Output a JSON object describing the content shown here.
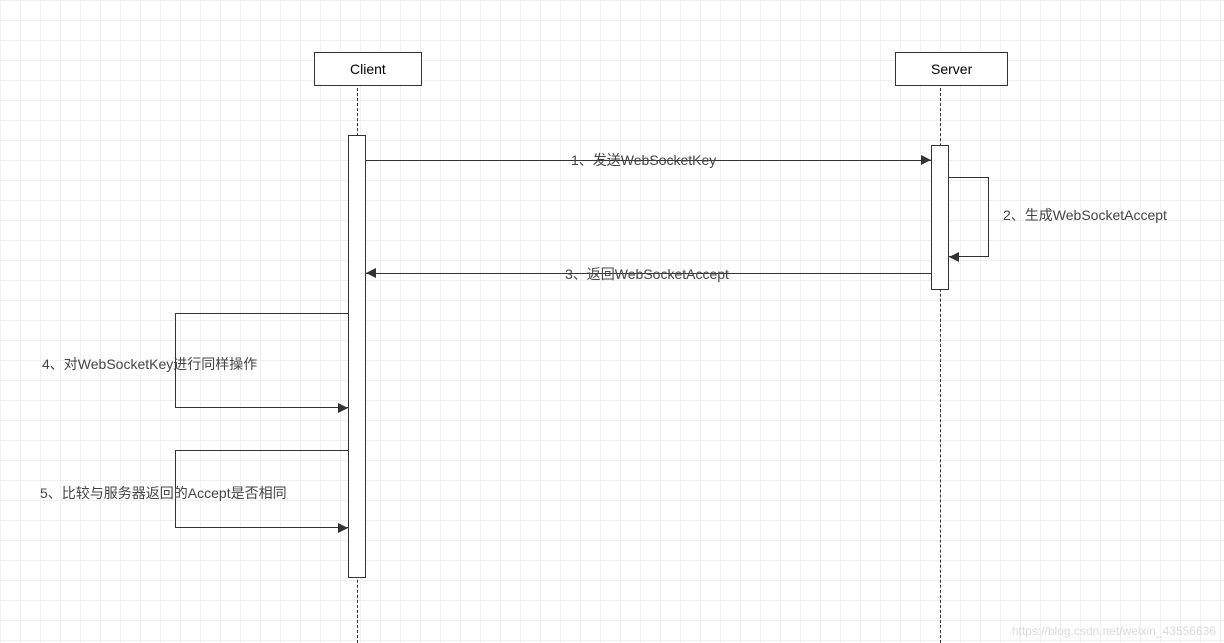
{
  "actors": {
    "client": "Client",
    "server": "Server"
  },
  "messages": {
    "msg1": "1、发送WebSocketKey",
    "msg2": "2、生成WebSocketAccept",
    "msg3": "3、返回WebSocketAccept",
    "msg4": "4、对WebSocketKey进行同样操作",
    "msg5": "5、比较与服务器返回的Accept是否相同"
  },
  "watermark": "https://blog.csdn.net/weixin_43556636"
}
